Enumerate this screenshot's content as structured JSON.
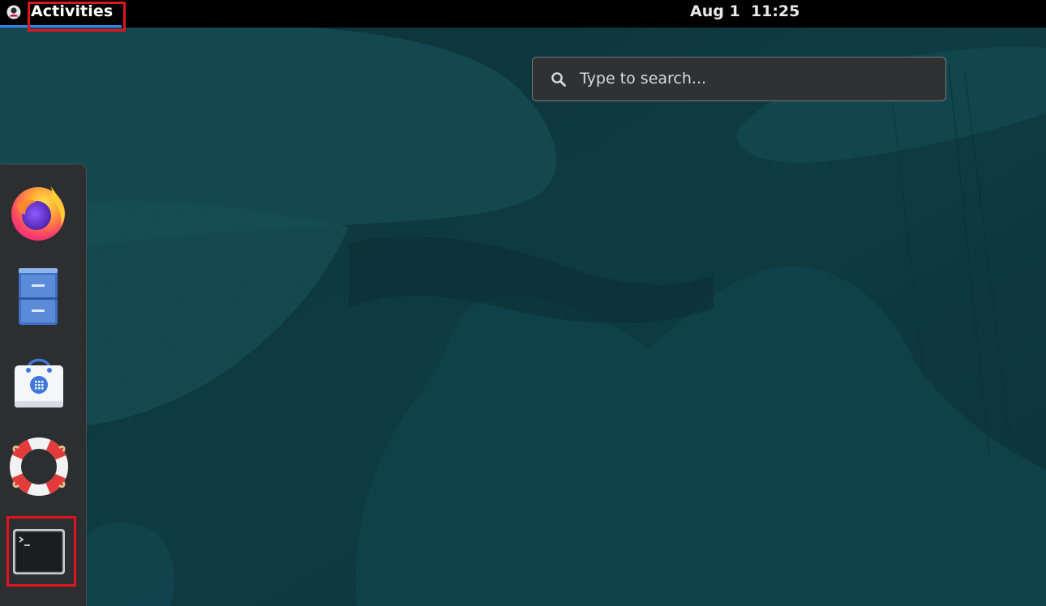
{
  "topbar": {
    "activities_label": "Activities",
    "clock": "Aug 1  11:25"
  },
  "search": {
    "placeholder": "Type to search..."
  },
  "dash": {
    "items": [
      {
        "app": "Firefox",
        "icon": "firefox-icon"
      },
      {
        "app": "Files",
        "icon": "file-cabinet-icon"
      },
      {
        "app": "Software",
        "icon": "shopping-bag-icon"
      },
      {
        "app": "Help",
        "icon": "lifebuoy-icon"
      },
      {
        "app": "Terminal",
        "icon": "terminal-icon"
      }
    ]
  },
  "colors": {
    "topbar_bg": "#000000",
    "accent": "#3584e4",
    "highlight_box": "#e0141e",
    "wallpaper_base": "#0f3a40",
    "dash_bg": "#2c2e30",
    "search_bg": "#2f3133"
  }
}
